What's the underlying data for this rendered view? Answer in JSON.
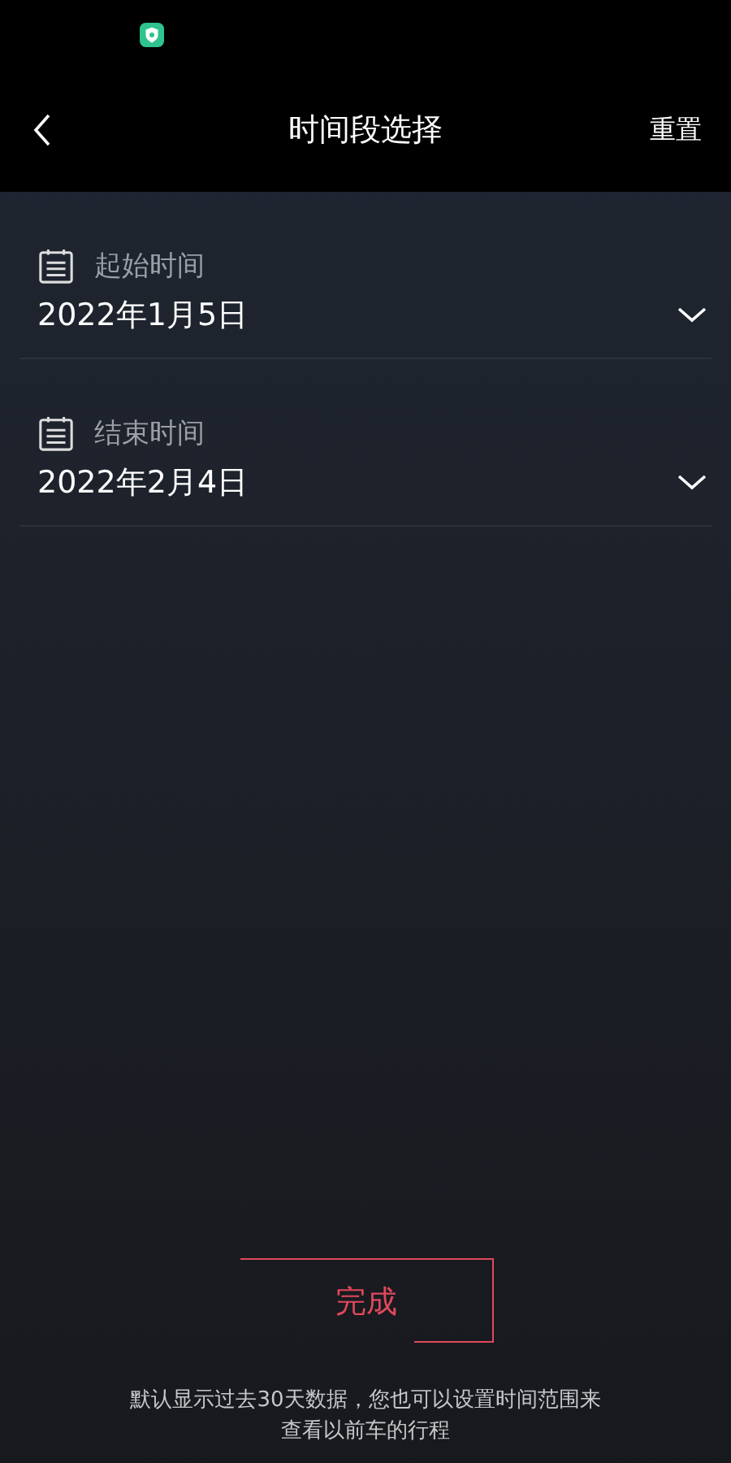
{
  "header": {
    "title": "时间段选择",
    "action": "重置"
  },
  "fields": [
    {
      "label": "起始时间",
      "value": "2022年1月5日"
    },
    {
      "label": "结束时间",
      "value": "2022年2月4日"
    }
  ],
  "confirm_button": "完成",
  "note": "默认显示过去30天数据，您也可以设置时间范围来查看以前车的行程"
}
